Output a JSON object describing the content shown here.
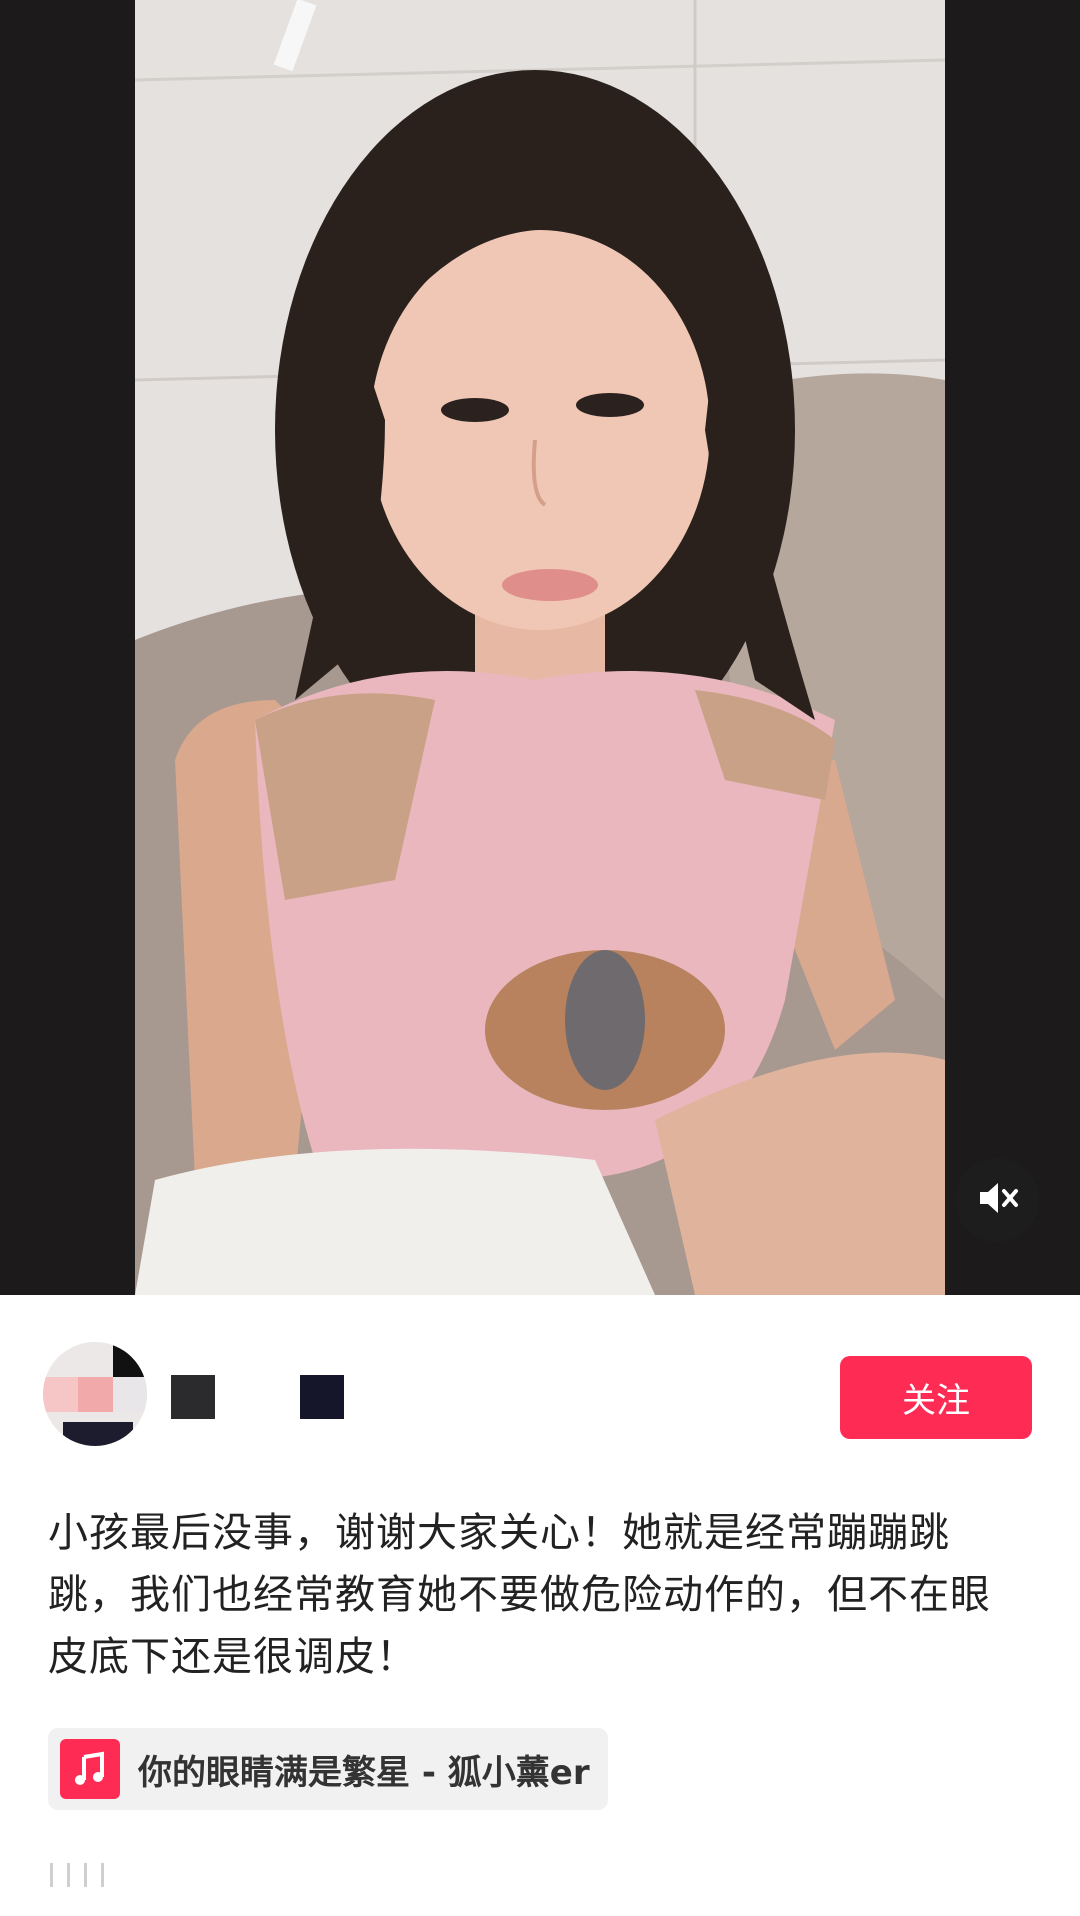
{
  "video": {
    "mute_icon": "speaker-muted-icon"
  },
  "author": {
    "avatar_icon": "avatar",
    "follow_label": "关注"
  },
  "post": {
    "caption": "小孩最后没事，谢谢大家关心！她就是经常蹦蹦跳跳，我们也经常教育她不要做危险动作的，但不在眼皮底下还是很调皮！"
  },
  "music": {
    "icon": "music-note-icon",
    "title": "你的眼睛满是繁星 - 狐小薰er"
  },
  "colors": {
    "accent": "#fe2c55",
    "video_bg": "#1d1a1b"
  }
}
